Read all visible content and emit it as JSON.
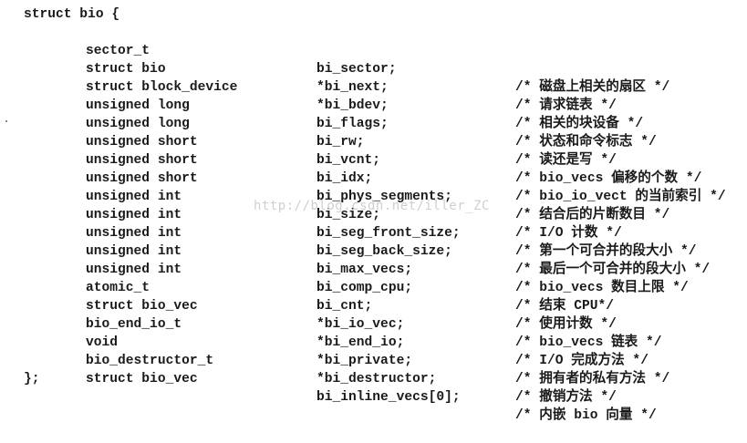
{
  "code": {
    "open": "struct bio {",
    "close": "};",
    "fields": [
      {
        "type": "sector_t",
        "name": "bi_sector;",
        "comment": "/* 磁盘上相关的扇区 */"
      },
      {
        "type": "struct bio",
        "name": "*bi_next;",
        "comment": "/* 请求链表 */"
      },
      {
        "type": "struct block_device",
        "name": "*bi_bdev;",
        "comment": "/* 相关的块设备 */"
      },
      {
        "type": "unsigned long",
        "name": "bi_flags;",
        "comment": "/* 状态和命令标志 */"
      },
      {
        "type": "unsigned long",
        "name": "bi_rw;",
        "comment": "/* 读还是写 */"
      },
      {
        "type": "unsigned short",
        "name": "bi_vcnt;",
        "comment": "/* bio_vecs 偏移的个数 */"
      },
      {
        "type": "unsigned short",
        "name": "bi_idx;",
        "comment": "/* bio_io_vect 的当前索引 */"
      },
      {
        "type": "unsigned short",
        "name": "bi_phys_segments;",
        "comment": "/* 结合后的片断数目 */"
      },
      {
        "type": "unsigned int",
        "name": "bi_size;",
        "comment": "/* I/O 计数 */"
      },
      {
        "type": "unsigned int",
        "name": "bi_seg_front_size;",
        "comment": "/* 第一个可合并的段大小 */"
      },
      {
        "type": "unsigned int",
        "name": "bi_seg_back_size;",
        "comment": "/* 最后一个可合并的段大小 */"
      },
      {
        "type": "unsigned int",
        "name": "bi_max_vecs;",
        "comment": "/* bio_vecs 数目上限 */"
      },
      {
        "type": "unsigned int",
        "name": "bi_comp_cpu;",
        "comment": "/* 结束 CPU*/"
      },
      {
        "type": "atomic_t",
        "name": "bi_cnt;",
        "comment": "/* 使用计数 */"
      },
      {
        "type": "struct bio_vec",
        "name": "*bi_io_vec;",
        "comment": "/* bio_vecs 链表 */"
      },
      {
        "type": "bio_end_io_t",
        "name": "*bi_end_io;",
        "comment": "/* I/O 完成方法 */"
      },
      {
        "type": "void",
        "name": "*bi_private;",
        "comment": "/* 拥有者的私有方法 */"
      },
      {
        "type": "bio_destructor_t",
        "name": "*bi_destructor;",
        "comment": "/* 撤销方法 */"
      },
      {
        "type": "struct bio_vec",
        "name": "bi_inline_vecs[0];",
        "comment": "/* 内嵌 bio 向量 */"
      }
    ]
  },
  "watermark": "http://blog.csdn.net/iller_ZC"
}
